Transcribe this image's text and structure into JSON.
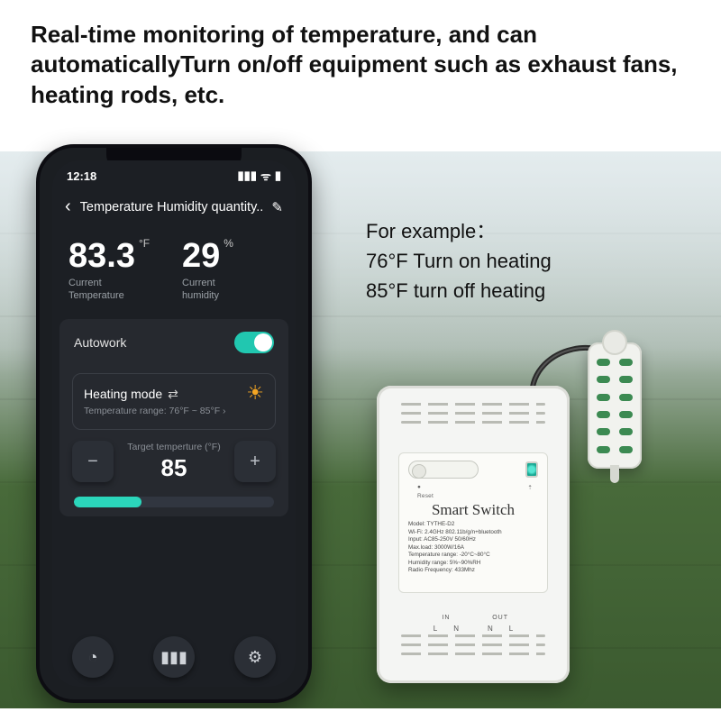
{
  "headline": "Real-time monitoring of temperature, and can automaticallyTurn on/off equipment such as exhaust fans, heating rods, etc.",
  "example": {
    "label": "For example：",
    "line1": "76°F   Turn on heating",
    "line2": "85°F   turn off  heating"
  },
  "phone": {
    "status_time": "12:18",
    "title": "Temperature Humidity quantity...",
    "temp_value": "83.3",
    "temp_unit": "°F",
    "temp_label_l1": "Current",
    "temp_label_l2": "Temperature",
    "hum_value": "29",
    "hum_unit": "%",
    "hum_label_l1": "Current",
    "hum_label_l2": "humidity",
    "autowork_label": "Autowork",
    "autowork_on": true,
    "mode_title": "Heating mode",
    "range_label": "Temperature range:  76°F ~ 85°F  ›",
    "target_label": "Target temperture  (°F)",
    "target_value": "85"
  },
  "device": {
    "brand": "Smart Switch",
    "reset_label": "Reset",
    "wifi_label": "⇡",
    "specs": [
      "Model: TYTHE-D2",
      "Wi-Fi: 2.4GHz 802.11b/g/n+bluetooth",
      "Input: AC85-250V 50/60Hz",
      "Max.load: 3000W/16A",
      "Temperature range: -20°C~80°C",
      "Humidity range: 5%~90%RH",
      "Radio Frequency: 433Mhz"
    ],
    "terminals": {
      "in": "IN",
      "out": "OUT",
      "l": "L",
      "n": "N"
    }
  }
}
